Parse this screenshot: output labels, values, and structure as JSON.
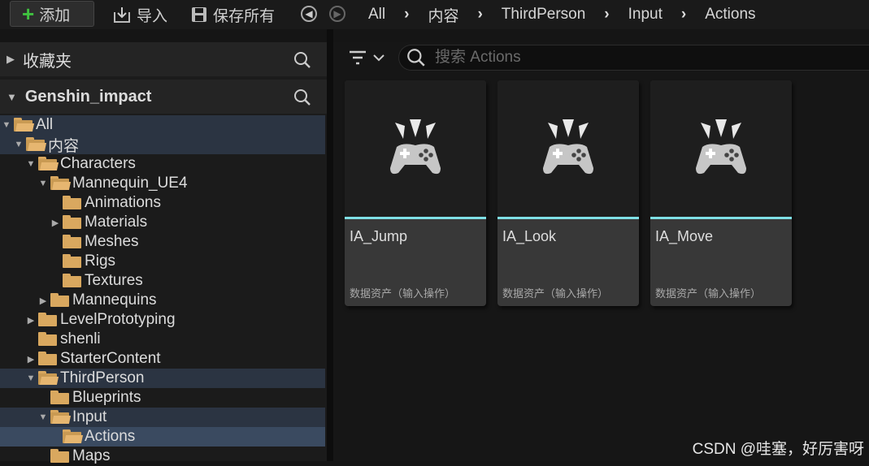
{
  "toolbar": {
    "add_label": "添加",
    "import_label": "导入",
    "save_all_label": "保存所有"
  },
  "breadcrumb": [
    "All",
    "内容",
    "ThirdPerson",
    "Input",
    "Actions"
  ],
  "favorites": {
    "label": "收藏夹"
  },
  "project": {
    "label": "Genshin_impact"
  },
  "tree": [
    {
      "label": "All",
      "arrow": "down",
      "open": true
    },
    {
      "label": "内容",
      "arrow": "down",
      "open": true
    },
    {
      "label": "Characters",
      "arrow": "down",
      "open": true
    },
    {
      "label": "Mannequin_UE4",
      "arrow": "down",
      "open": true
    },
    {
      "label": "Animations",
      "arrow": "none",
      "open": false
    },
    {
      "label": "Materials",
      "arrow": "right",
      "open": false
    },
    {
      "label": "Meshes",
      "arrow": "none",
      "open": false
    },
    {
      "label": "Rigs",
      "arrow": "none",
      "open": false
    },
    {
      "label": "Textures",
      "arrow": "none",
      "open": false
    },
    {
      "label": "Mannequins",
      "arrow": "right",
      "open": false
    },
    {
      "label": "LevelPrototyping",
      "arrow": "right",
      "open": false
    },
    {
      "label": "shenli",
      "arrow": "none",
      "open": false
    },
    {
      "label": "StarterContent",
      "arrow": "right",
      "open": false
    },
    {
      "label": "ThirdPerson",
      "arrow": "down",
      "open": true
    },
    {
      "label": "Blueprints",
      "arrow": "none",
      "open": false
    },
    {
      "label": "Input",
      "arrow": "down",
      "open": true
    },
    {
      "label": "Actions",
      "arrow": "none",
      "open": true
    },
    {
      "label": "Maps",
      "arrow": "none",
      "open": false
    }
  ],
  "search": {
    "placeholder": "搜索 Actions"
  },
  "assets": [
    {
      "name": "IA_Jump",
      "type": "数据资产（输入操作）"
    },
    {
      "name": "IA_Look",
      "type": "数据资产（输入操作）"
    },
    {
      "name": "IA_Move",
      "type": "数据资产（输入操作）"
    }
  ],
  "watermark": "CSDN @哇塞，好厉害呀",
  "colors": {
    "accent_line": "#7fe0e6",
    "folder": "#d9a85f",
    "add_plus": "#3fc13f"
  }
}
